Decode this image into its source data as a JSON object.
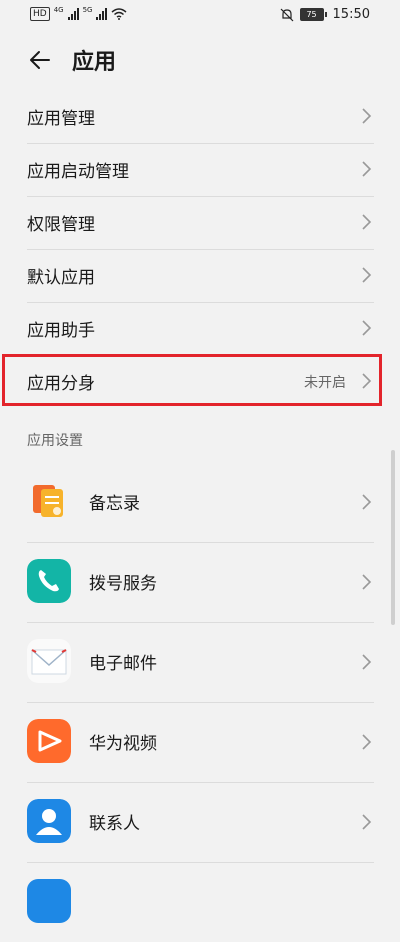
{
  "status_bar": {
    "hd_label": "HD",
    "network_1": "4G",
    "network_2": "5G",
    "battery": "75",
    "time": "15:50"
  },
  "header": {
    "title": "应用"
  },
  "settings_items": [
    {
      "label": "应用管理",
      "value": ""
    },
    {
      "label": "应用启动管理",
      "value": ""
    },
    {
      "label": "权限管理",
      "value": ""
    },
    {
      "label": "默认应用",
      "value": ""
    },
    {
      "label": "应用助手",
      "value": ""
    },
    {
      "label": "应用分身",
      "value": "未开启"
    }
  ],
  "section_title": "应用设置",
  "apps": [
    {
      "label": "备忘录",
      "icon": "notepad-icon",
      "color": "#f5a623"
    },
    {
      "label": "拨号服务",
      "icon": "phone-icon",
      "color": "#13b5a6"
    },
    {
      "label": "电子邮件",
      "icon": "email-icon",
      "color": "#ffffff"
    },
    {
      "label": "华为视频",
      "icon": "video-icon",
      "color": "#ff6a2c"
    },
    {
      "label": "联系人",
      "icon": "contacts-icon",
      "color": "#1e88e5"
    }
  ],
  "highlight_color": "#e3242b"
}
